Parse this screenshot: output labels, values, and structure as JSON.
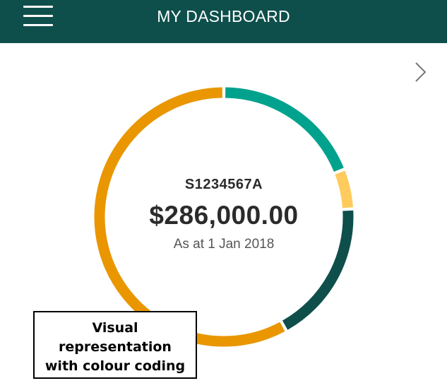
{
  "header": {
    "title": "MY DASHBOARD",
    "menu_icon": "hamburger-menu-icon",
    "background_color": "#0e4f4b"
  },
  "navigation": {
    "next_icon": "chevron-right-icon"
  },
  "summary": {
    "account_id": "S1234567A",
    "balance": "$286,000.00",
    "as_at": "As at 1 Jan 2018"
  },
  "donut": {
    "segments": [
      {
        "color": "#00a28d",
        "share": 0.19
      },
      {
        "color": "#ffcb5c",
        "share": 0.05
      },
      {
        "color": "#0e4f4b",
        "share": 0.18
      },
      {
        "color": "#e99600",
        "share": 0.58
      }
    ]
  },
  "callout": {
    "lines": [
      "Visual",
      "representation",
      "with colour coding"
    ]
  }
}
